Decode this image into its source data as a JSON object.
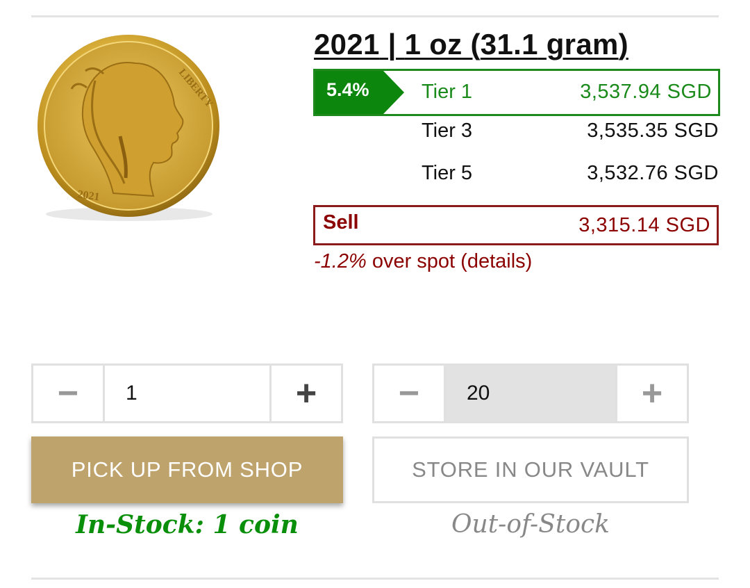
{
  "product": {
    "title_year": "2021",
    "title_sep": " | ",
    "title_weight": "1 oz",
    "title_paren_open": " (",
    "title_grams": "31.1",
    "title_gram_unit": " gram",
    "title_paren_close": ")"
  },
  "coin": {
    "inscription_year": "2021",
    "inscription_liberty": "LIBERTY",
    "icon": "buffalo-gold-coin"
  },
  "pricing": {
    "premium_badge": "5.4%",
    "tiers": [
      {
        "label": "Tier 1",
        "price": "3,537.94 SGD"
      },
      {
        "label": "Tier 3",
        "price": "3,535.35 SGD"
      },
      {
        "label": "Tier 5",
        "price": "3,532.76 SGD"
      }
    ],
    "sell_label": "Sell",
    "sell_price": "3,315.14 SGD",
    "spot_pct": "-1.2%",
    "spot_text": " over spot (details)"
  },
  "pickup": {
    "minus": "−",
    "plus": "+",
    "quantity": "1",
    "button_label": "PICK UP FROM SHOP",
    "stock_status": "In-Stock: 1 coin"
  },
  "vault": {
    "minus": "−",
    "plus": "+",
    "quantity": "20",
    "button_label": "STORE IN OUR VAULT",
    "stock_status": "Out-of-Stock"
  },
  "colors": {
    "buy_green": "#1a8a1a",
    "sell_red": "#8b0000",
    "gold_button": "#bea36c"
  }
}
